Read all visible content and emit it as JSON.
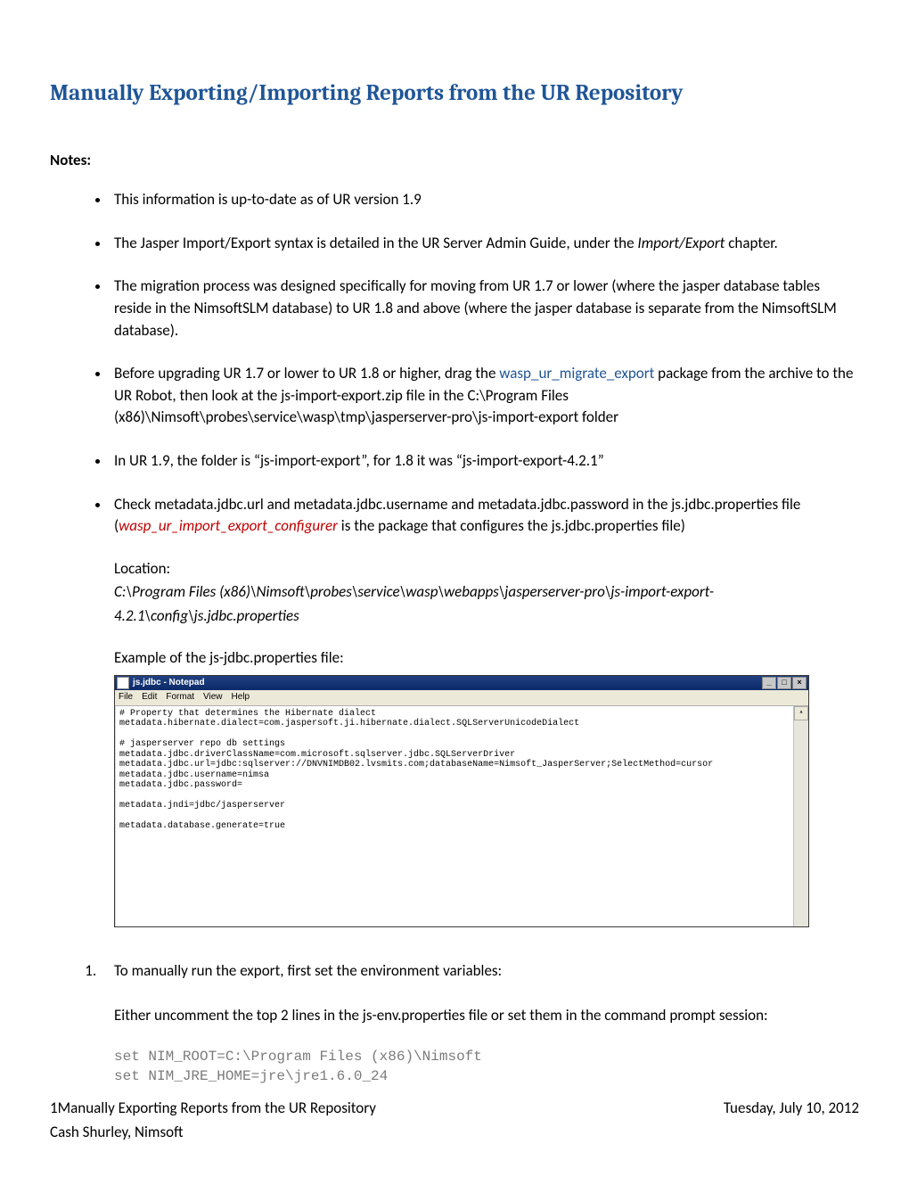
{
  "title": "Manually Exporting/Importing Reports from the UR Repository",
  "notes_label": "Notes:",
  "bullets": {
    "b1": "This information is up-to-date as of UR version 1.9",
    "b2_pre": "The Jasper Import/Export syntax is detailed in the UR Server Admin Guide, under the ",
    "b2_em": "Import/Export",
    "b2_post": " chapter.",
    "b3": "The migration process was designed specifically for moving from UR 1.7 or lower (where the jasper database tables reside in the NimsoftSLM database) to UR 1.8 and above (where the jasper database is separate from the NimsoftSLM database).",
    "b4_pre": "Before upgrading UR 1.7 or lower to UR 1.8 or higher, drag the ",
    "b4_link": "wasp_ur_migrate_export",
    "b4_post": " package from the archive to the UR Robot, then look at the js-import-export.zip file in the C:\\Program Files (x86)\\Nimsoft\\probes\\service\\wasp\\tmp\\jasperserver-pro\\js-import-export folder",
    "b5": "In UR 1.9, the folder is “js-import-export”, for 1.8 it was “js-import-export-4.2.1”",
    "b6_pre": "Check metadata.jdbc.url and metadata.jdbc.username and metadata.jdbc.password in the js.jdbc.properties file (",
    "b6_red": "wasp_ur_import_export_configurer",
    "b6_post": " is the package that configures the js.jdbc.properties file)",
    "location_label": "Location:",
    "location_path": "C:\\Program Files (x86)\\Nimsoft\\probes\\service\\wasp\\webapps\\jasperserver-pro\\js-import-export-4.2.1\\config\\js.jdbc.properties"
  },
  "example_label": "Example of the js-jdbc.properties file:",
  "notepad": {
    "title": "js.jdbc - Notepad",
    "menus": {
      "file": "File",
      "edit": "Edit",
      "format": "Format",
      "view": "View",
      "help": "Help"
    },
    "winbtns": {
      "min": "_",
      "max": "□",
      "close": "×"
    },
    "content": "# Property that determines the Hibernate dialect\nmetadata.hibernate.dialect=com.jaspersoft.ji.hibernate.dialect.SQLServerUnicodeDialect\n\n# jasperserver repo db settings\nmetadata.jdbc.driverClassName=com.microsoft.sqlserver.jdbc.SQLServerDriver\nmetadata.jdbc.url=jdbc:sqlserver://DNVNIMDB02.lvsmits.com;databaseName=Nimsoft_JasperServer;SelectMethod=cursor\nmetadata.jdbc.username=nimsa\nmetadata.jdbc.password=\n\nmetadata.jndi=jdbc/jasperserver\n\nmetadata.database.generate=true\n\n\n\n\n\n\n\n\n\n"
  },
  "step1_text": "To manually run the export, first set the environment variables:",
  "step1_sub": "Either uncomment the top 2 lines in the js-env.properties file or set them in the command prompt session:",
  "code": "set NIM_ROOT=C:\\Program Files (x86)\\Nimsoft\nset NIM_JRE_HOME=jre\\jre1.6.0_24",
  "footer": {
    "page_num": "1",
    "doc_title": "Manually Exporting Reports from the UR Repository",
    "date": "Tuesday, July 10, 2012",
    "author": "Cash Shurley, Nimsoft"
  }
}
